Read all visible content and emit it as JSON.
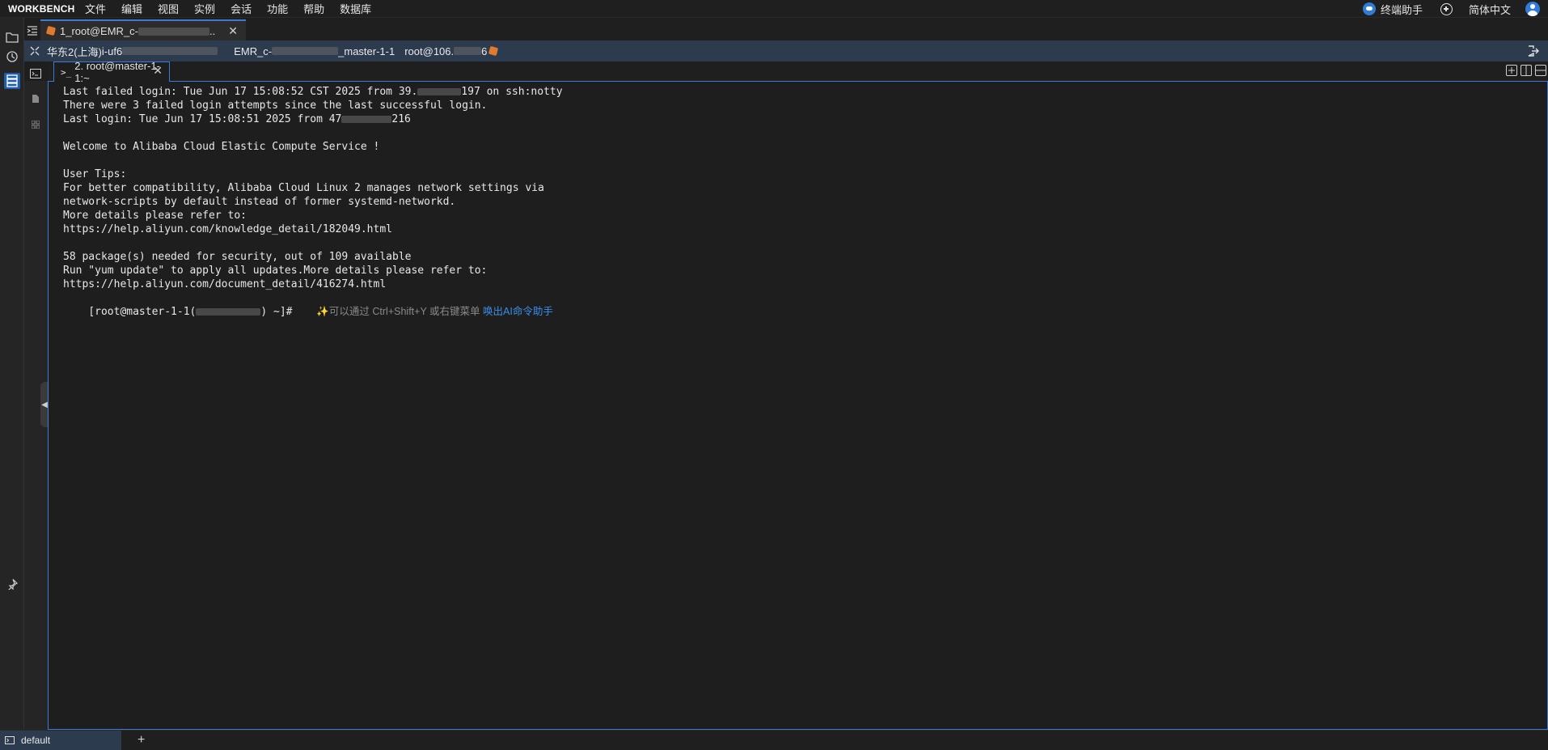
{
  "menubar": {
    "brand": "WORKBENCH",
    "items": [
      "文件",
      "编辑",
      "视图",
      "实例",
      "会话",
      "功能",
      "帮助",
      "数据库"
    ],
    "assistant_label": "终端助手",
    "language_label": "简体中文"
  },
  "activity_icons": [
    "folder-icon",
    "history-icon",
    "server-list-icon"
  ],
  "session_tab": {
    "label_prefix": "1_root@EMR_c-",
    "label_suffix": ".."
  },
  "infobar": {
    "region": "华东2(上海)",
    "instance_prefix": "i-uf6",
    "cluster_prefix": "EMR_c-",
    "node_suffix": "_master-1-1",
    "user_host_prefix": "root@106.",
    "user_host_suffix": "6"
  },
  "term_tab": {
    "label": "2. root@master-1-1:~"
  },
  "terminal": {
    "lines": [
      "Last failed login: Tue Jun 17 15:08:52 CST 2025 from 39.",
      "There were 3 failed login attempts since the last successful login.",
      "Last login: Tue Jun 17 15:08:51 2025 from 47",
      "",
      "Welcome to Alibaba Cloud Elastic Compute Service !",
      "",
      "User Tips:",
      "For better compatibility, Alibaba Cloud Linux 2 manages network settings via",
      "network-scripts by default instead of former systemd-networkd.",
      "More details please refer to:",
      "https://help.aliyun.com/knowledge_detail/182049.html",
      "",
      "58 package(s) needed for security, out of 109 available",
      "Run \"yum update\" to apply all updates.More details please refer to:",
      "https://help.aliyun.com/document_detail/416274.html"
    ],
    "line1_suffix": "197 on ssh:notty",
    "line3_suffix": "216",
    "prompt_prefix": "[root@master-1-1(",
    "prompt_suffix": ") ~]# ",
    "hint_text": "可以通过 Ctrl+Shift+Y 或右键菜单",
    "hint_link": "唤出AI命令助手"
  },
  "statusbar": {
    "tab_label": "default",
    "add_label": "+"
  },
  "colors": {
    "accent": "#3a7bd5",
    "infobar_bg": "#2d3b4e",
    "terminal_bg": "#1e1e1e",
    "hint_link": "#3b8eea"
  }
}
